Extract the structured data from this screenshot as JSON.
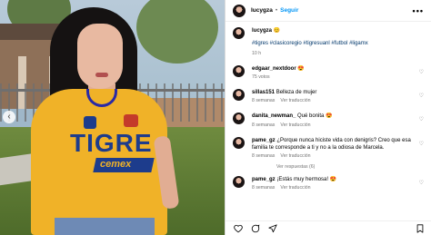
{
  "post": {
    "username": "lucygza",
    "follow_label": "Seguir",
    "more_label": "•••",
    "dot": "•"
  },
  "shirt": {
    "brand": "TIGRE",
    "sponsor": "cemex"
  },
  "caption": {
    "username": "lucygza",
    "text": "😊",
    "hashtags": "#tigres #clasicoregio #tigresuanl #futbol #ligamx",
    "time": "10 h"
  },
  "comments": [
    {
      "user": "edgaar_nextdoor",
      "text": "😍",
      "meta1": "75 votos",
      "meta2": ""
    },
    {
      "user": "sillas151",
      "text": "Belleza de mujer",
      "meta1": "8 semanas",
      "meta2": "Ver traducción"
    },
    {
      "user": "danita_newman_",
      "text": "Qué bonita 😍",
      "meta1": "8 semanas",
      "meta2": "Ver traducción"
    },
    {
      "user": "pame_gz",
      "text": "¿Porque nunca hiciste vida con denigris? Creo que esa familia te corresponde a ti y no a la odiosa de Marcela.",
      "meta1": "8 semanas",
      "meta2": "Ver traducción"
    },
    {
      "user": "pame_gz",
      "text": "¡Estás muy hermosa! 😍",
      "meta1": "8 semanas",
      "meta2": "Ver traducción"
    }
  ],
  "view_replies": "Ver respuestas (6)",
  "icons": {
    "like": "heart-icon",
    "comment": "comment-icon",
    "share": "share-icon",
    "save": "bookmark-icon"
  },
  "colors": {
    "accent": "#0095f6",
    "shirt": "#f0b228",
    "shirt_text": "#1d3c8c"
  }
}
